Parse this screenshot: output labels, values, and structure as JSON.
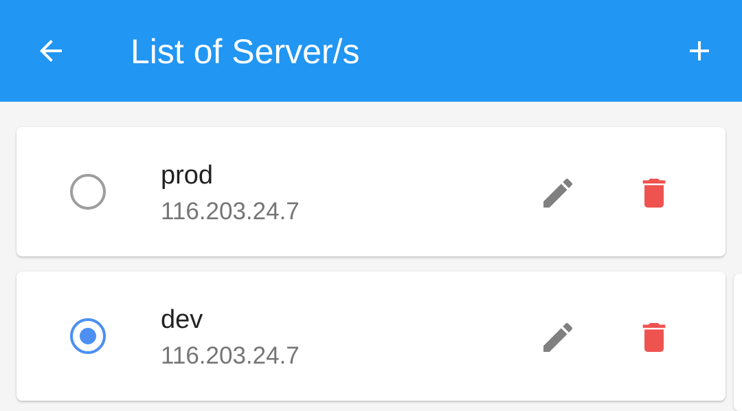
{
  "header": {
    "title": "List of Server/s",
    "back_icon": "arrow-back-icon",
    "add_icon": "plus-icon",
    "background_color": "#2196f3"
  },
  "servers": [
    {
      "name": "prod",
      "ip": "116.203.24.7",
      "selected": false
    },
    {
      "name": "dev",
      "ip": "116.203.24.7",
      "selected": true
    }
  ],
  "colors": {
    "radio_selected": "#4d8ff2",
    "radio_unselected": "#9e9e9e",
    "edit_icon": "#808080",
    "delete_icon": "#ef5350"
  },
  "icons": {
    "edit": "pencil-icon",
    "delete": "trash-icon"
  }
}
